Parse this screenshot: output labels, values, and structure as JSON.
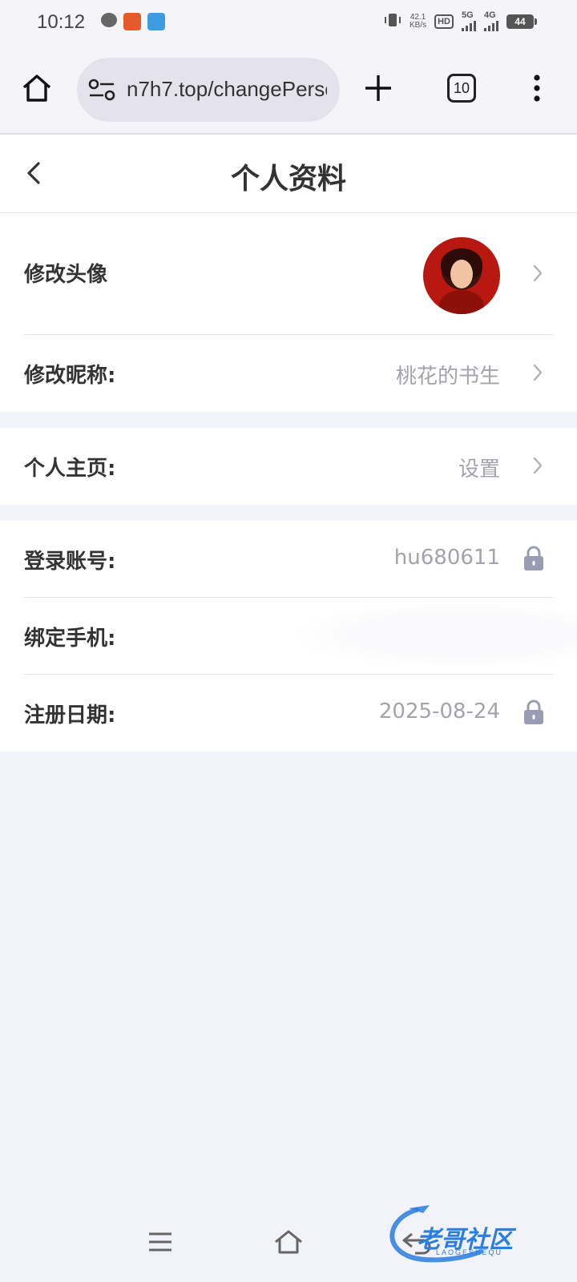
{
  "status_bar": {
    "time": "10:12",
    "net_speed_value": "42.1",
    "net_speed_unit": "KB/s",
    "hd_label": "HD",
    "signal_1": "5G",
    "signal_2": "4G",
    "battery": "44"
  },
  "browser": {
    "url": "n7h7.top/changePersc",
    "tab_count": "10"
  },
  "header": {
    "title": "个人资料"
  },
  "profile": {
    "avatar_label": "修改头像",
    "nickname_label": "修改昵称:",
    "nickname_value": "桃花的书生",
    "homepage_label": "个人主页:",
    "homepage_value": "设置",
    "account_label": "登录账号:",
    "account_value": "hu680611",
    "phone_label": "绑定手机:",
    "register_label": "注册日期:",
    "register_value": "2025-08-24"
  },
  "watermark": {
    "text": "老哥社区",
    "sub": "LAOGESHEQU"
  },
  "colors": {
    "background": "#f2f3f8",
    "card": "#ffffff",
    "value_text": "#a3a3ab",
    "lock_icon": "#9a9cb3",
    "watermark": "#2a7de1"
  },
  "icons": {
    "home": "home-icon",
    "tune": "site-settings-icon",
    "plus": "plus-icon",
    "more": "more-vert-icon",
    "back": "chevron-left-icon",
    "chevron": "chevron-right-icon",
    "lock": "lock-icon"
  }
}
